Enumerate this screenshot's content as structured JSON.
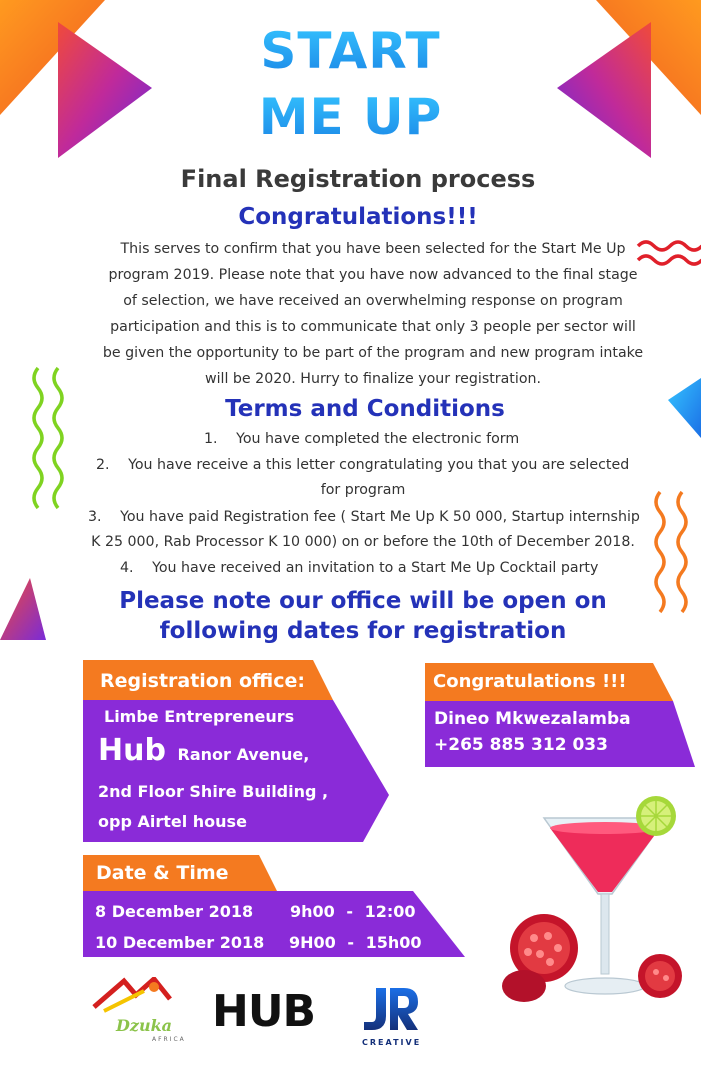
{
  "header": {
    "title_line1": "START",
    "title_line2": "ME UP",
    "subtitle": "Final Registration process",
    "congrats": "Congratulations!!!"
  },
  "intro": {
    "lines": [
      "This serves to confirm that you have been selected for the Start Me Up",
      "program 2019. Please note that you have now advanced to the final stage",
      "of selection, we have received an overwhelming response on program",
      "participation and this is to communicate that only 3 people per sector will",
      "be given the opportunity to be part of the program and new program intake",
      "will be 2020. Hurry to finalize your registration."
    ]
  },
  "terms": {
    "title": "Terms and Conditions",
    "items": [
      {
        "num": "1.",
        "line1": "You have completed the electronic form"
      },
      {
        "num": "2.",
        "line1": "You have receive a this letter congratulating you that you are selected",
        "line2": "for program"
      },
      {
        "num": "3.",
        "line1": "You have paid Registration fee ( Start Me Up K 50 000, Startup internship",
        "line2": "K 25 000, Rab Processor K 10 000) on or before the 10th of December 2018."
      },
      {
        "num": "4.",
        "line1": "You have received an invitation to a Start Me Up Cocktail party"
      }
    ]
  },
  "note": {
    "line1": "Please note our office will be open on",
    "line2": "following dates for registration"
  },
  "registration_office": {
    "label": "Registration office:",
    "line1": "Limbe Entrepreneurs",
    "hub": "Hub",
    "line2": "Ranor Avenue,",
    "line3": "2nd Floor Shire Building ,",
    "line4": "opp Airtel house"
  },
  "contact": {
    "label": "Congratulations !!!",
    "name": "Dineo Mkwezalamba",
    "phone": "+265 885 312 033"
  },
  "date_time": {
    "label": "Date & Time",
    "rows": [
      {
        "date": "8 December 2018",
        "time_start": "9h00",
        "dash": "-",
        "time_end": "12:00"
      },
      {
        "date": "10 December 2018",
        "time_start": "9H00",
        "dash": "-",
        "time_end": "15h00"
      }
    ]
  },
  "logos": {
    "dzuka": "Dzuka",
    "dzuka_sub": "AFRICA",
    "hub": "HUB",
    "jr": "JR",
    "jr_sub": "CREATIVE"
  },
  "colors": {
    "blue_heading": "#2432b8",
    "orange": "#f47a20",
    "purple": "#8a2bd8",
    "title_gradient_top": "#35c4ff",
    "title_gradient_bottom": "#1b86e6"
  }
}
